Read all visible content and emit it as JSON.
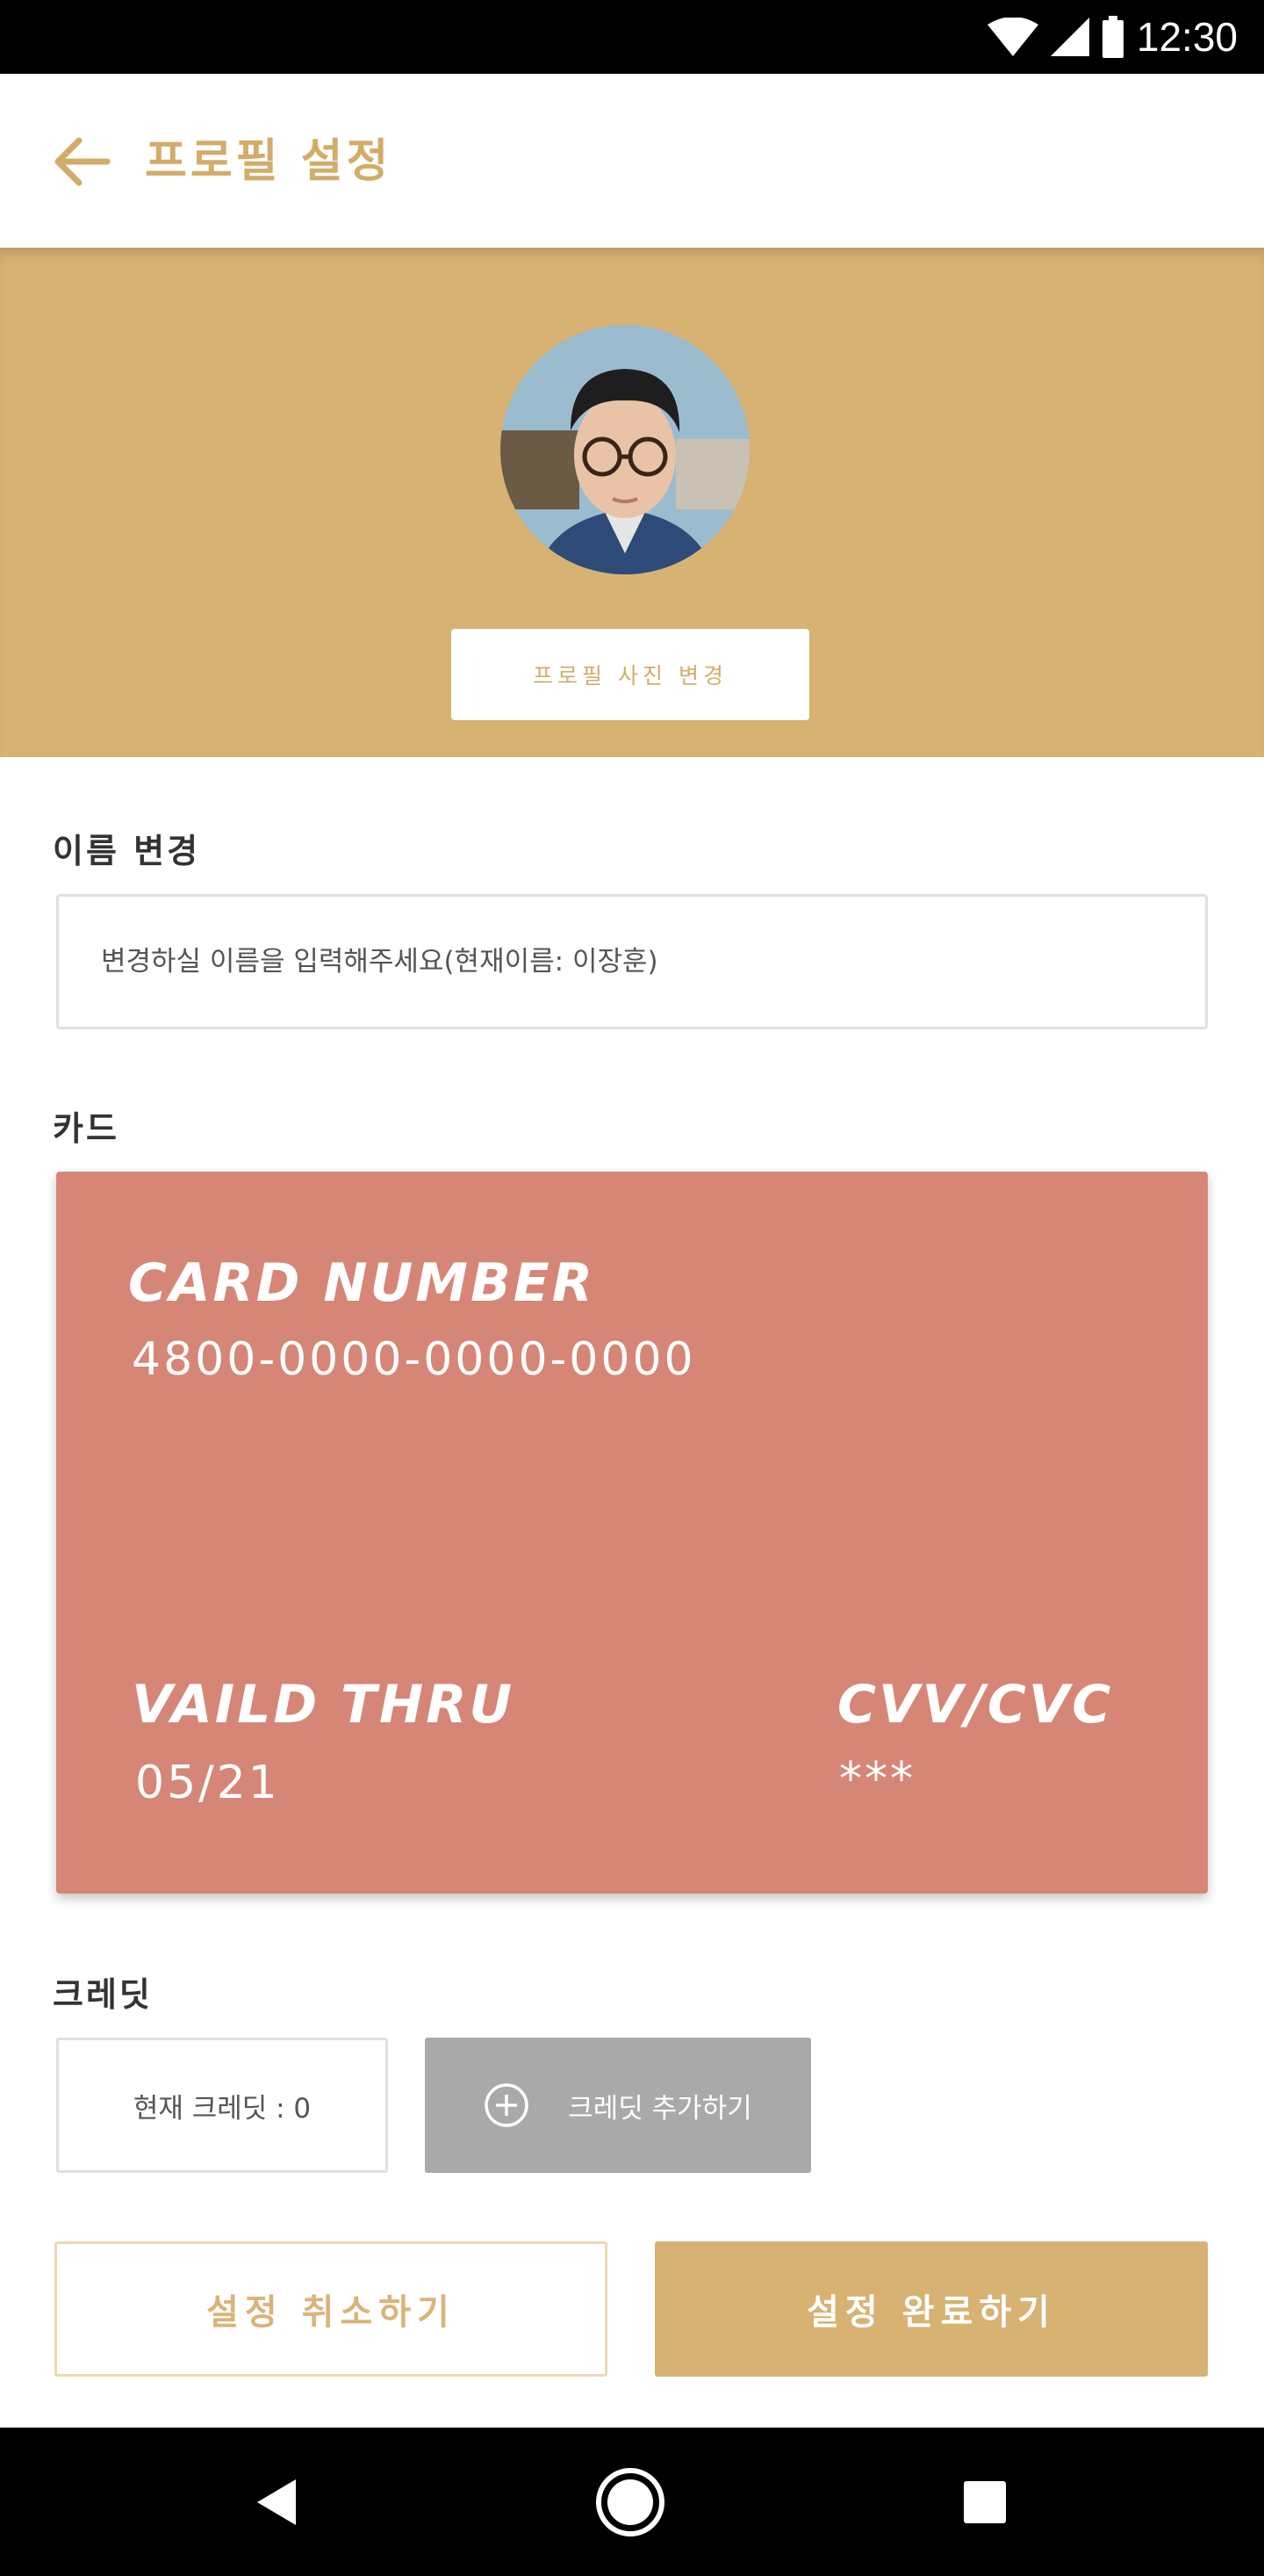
{
  "status_bar": {
    "time": "12:30"
  },
  "header": {
    "title": "프로필 설정"
  },
  "profile": {
    "change_photo_label": "프로필 사진 변경"
  },
  "name_section": {
    "label": "이름 변경",
    "placeholder": "변경하실 이름을 입력해주세요(현재이름: 이장훈)"
  },
  "card_section": {
    "label": "카드",
    "number_heading": "CARD NUMBER",
    "number": "4800-0000-0000-0000",
    "valid_heading": "VAILD THRU",
    "valid": "05/21",
    "cvv_heading": "CVV/CVC",
    "cvv": "***",
    "color": "#d68676"
  },
  "credit_section": {
    "label": "크레딧",
    "current": "현재 크레딧 : 0",
    "add_label": "크레딧 추가하기"
  },
  "actions": {
    "cancel_label": "설정 취소하기",
    "confirm_label": "설정 완료하기"
  },
  "colors": {
    "accent": "#d7b273",
    "card": "#d68676",
    "disabled": "#a9a9a9"
  }
}
